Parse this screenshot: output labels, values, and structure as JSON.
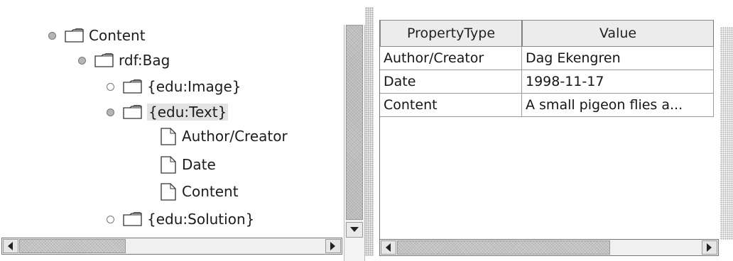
{
  "tree": {
    "nodes": [
      {
        "label": "Content",
        "kind": "folder",
        "handle": "expanded"
      },
      {
        "label": "rdf:Bag",
        "kind": "folder",
        "handle": "expanded"
      },
      {
        "label": "{edu:Image}",
        "kind": "folder",
        "handle": "collapsed"
      },
      {
        "label": "{edu:Text}",
        "kind": "folder",
        "handle": "expanded",
        "selected": true
      },
      {
        "label": "Author/Creator",
        "kind": "leaf"
      },
      {
        "label": "Date",
        "kind": "leaf"
      },
      {
        "label": "Content",
        "kind": "leaf"
      },
      {
        "label": "{edu:Solution}",
        "kind": "folder",
        "handle": "collapsed"
      }
    ]
  },
  "table": {
    "columns": [
      "PropertyType",
      "Value"
    ],
    "rows": [
      [
        "Author/Creator",
        "Dag Ekengren"
      ],
      [
        "Date",
        "1998-11-17"
      ],
      [
        "Content",
        "A small pigeon flies a..."
      ]
    ]
  },
  "icons": {
    "folder": "folder-icon",
    "leaf": "document-icon",
    "handle_expanded": "expanded-handle-icon",
    "handle_collapsed": "collapsed-handle-icon",
    "scroll_left": "arrow-left-icon",
    "scroll_right": "arrow-right-icon",
    "scroll_down": "arrow-down-icon"
  },
  "colors": {
    "selection_bg": "#e3e3e3",
    "header_bg": "#ececec",
    "grid_line": "#9a9a9a"
  }
}
